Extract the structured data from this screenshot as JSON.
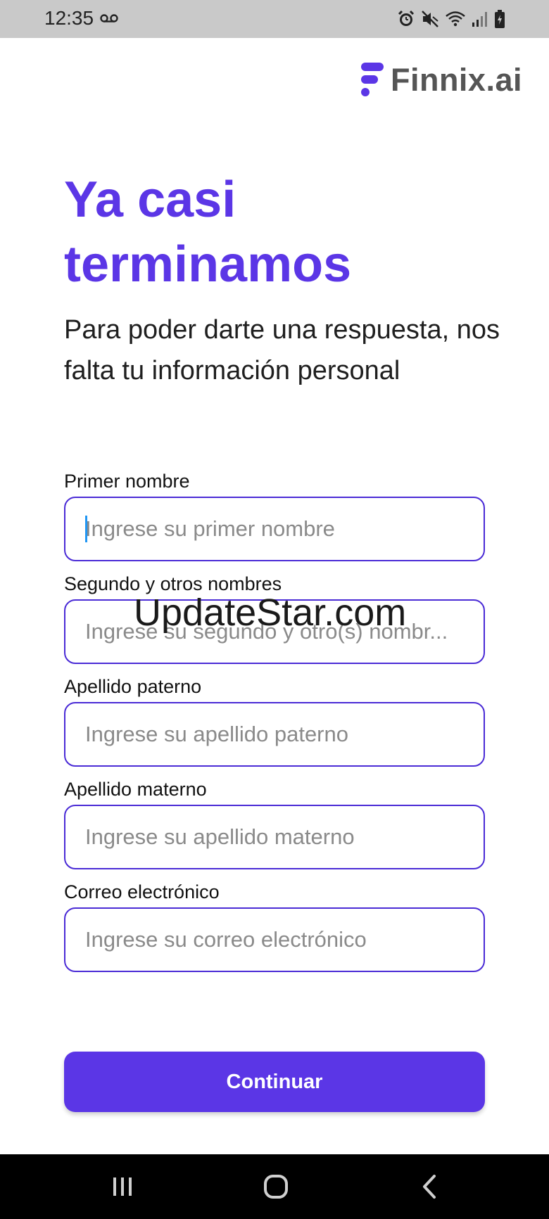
{
  "status_bar": {
    "time": "12:35",
    "icons": [
      "voicemail-icon",
      "alarm-icon",
      "mute-icon",
      "wifi-icon",
      "signal-icon",
      "battery-icon"
    ]
  },
  "brand": {
    "name": "Finnix.ai",
    "color": "#5b36e6"
  },
  "header": {
    "title": "Ya casi terminamos",
    "subtitle": "Para poder darte una respuesta, nos falta tu información personal"
  },
  "form": {
    "fields": [
      {
        "label": "Primer nombre",
        "placeholder": "Ingrese su primer nombre",
        "value": ""
      },
      {
        "label": "Segundo y otros nombres",
        "placeholder": "Ingrese su segundo y otro(s) nombr...",
        "value": ""
      },
      {
        "label": "Apellido paterno",
        "placeholder": "Ingrese su apellido paterno",
        "value": ""
      },
      {
        "label": "Apellido materno",
        "placeholder": "Ingrese su apellido materno",
        "value": ""
      },
      {
        "label": "Correo electrónico",
        "placeholder": "Ingrese su correo electrónico",
        "value": ""
      }
    ],
    "submit_label": "Continuar"
  },
  "watermark": "UpdateStar.com",
  "nav_bar": {
    "buttons": [
      "recent-apps-icon",
      "home-icon",
      "back-icon"
    ]
  }
}
